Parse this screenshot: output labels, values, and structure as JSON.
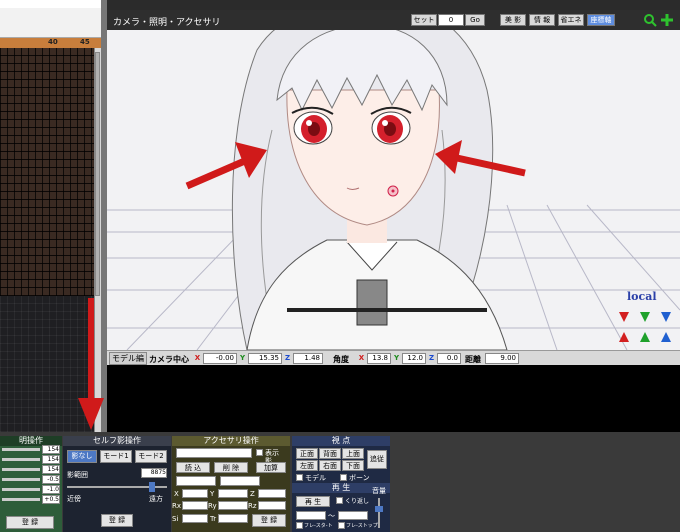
{
  "timeline": {
    "ruler": [
      "40",
      "45"
    ]
  },
  "viewport": {
    "title": "カメラ・照明・アクセサリ",
    "set_label": "セット",
    "set_value": "0",
    "go_label": "Go",
    "buttons": [
      "美 影",
      "情 報",
      "省エネ",
      "座標軸"
    ],
    "local_label": "local"
  },
  "status": {
    "mode": "モデル編",
    "camera_center": "カメラ中心",
    "x": "-0.00",
    "y": "15.35",
    "z": "1.48",
    "angle": "角度",
    "ax": "13.8",
    "ay": "12.0",
    "az": "0.0",
    "distance": "距離",
    "dist": "9.00"
  },
  "lighting": {
    "title": "明操作",
    "values": [
      "154",
      "154",
      "154",
      "-0.5",
      "-1.0",
      "+0.5"
    ],
    "register": "登 録"
  },
  "shadow": {
    "title": "セルフ影操作",
    "btn_off": "影なし",
    "mode1": "モード1",
    "mode2": "モード2",
    "range_label": "影範囲",
    "range_value": "8875",
    "near": "近傍",
    "far": "遠方",
    "register": "登 録"
  },
  "accessory": {
    "title": "アクセサリ操作",
    "show": "表示",
    "shadow": "影",
    "load": "読 込",
    "delete": "削 除",
    "add": "加算",
    "x": "X",
    "y": "Y",
    "z": "Z",
    "rx": "Rx",
    "ry": "Ry",
    "rz": "Rz",
    "si": "Si",
    "tr": "Tr",
    "register": "登 録"
  },
  "view": {
    "title": "視 点",
    "front": "正面",
    "back": "背面",
    "top": "上面",
    "left": "左面",
    "right": "右面",
    "bottom": "下面",
    "follow": "追従",
    "model": "モデル",
    "bone": "ボーン"
  },
  "play": {
    "title": "再 生",
    "play": "再 生",
    "repeat": "くり返し",
    "frame_start": "フレ-スタ-ト",
    "frame_stop": "フレ-ストップ",
    "tilde": "～",
    "volume": "音量"
  },
  "colors": {
    "arrow": "#d01a1a",
    "lighting_bg": "#2e5d3a",
    "shadow_bg": "#1d2330",
    "accessory_bg": "#3b3a1e",
    "view_bg": "#1f2a44"
  }
}
